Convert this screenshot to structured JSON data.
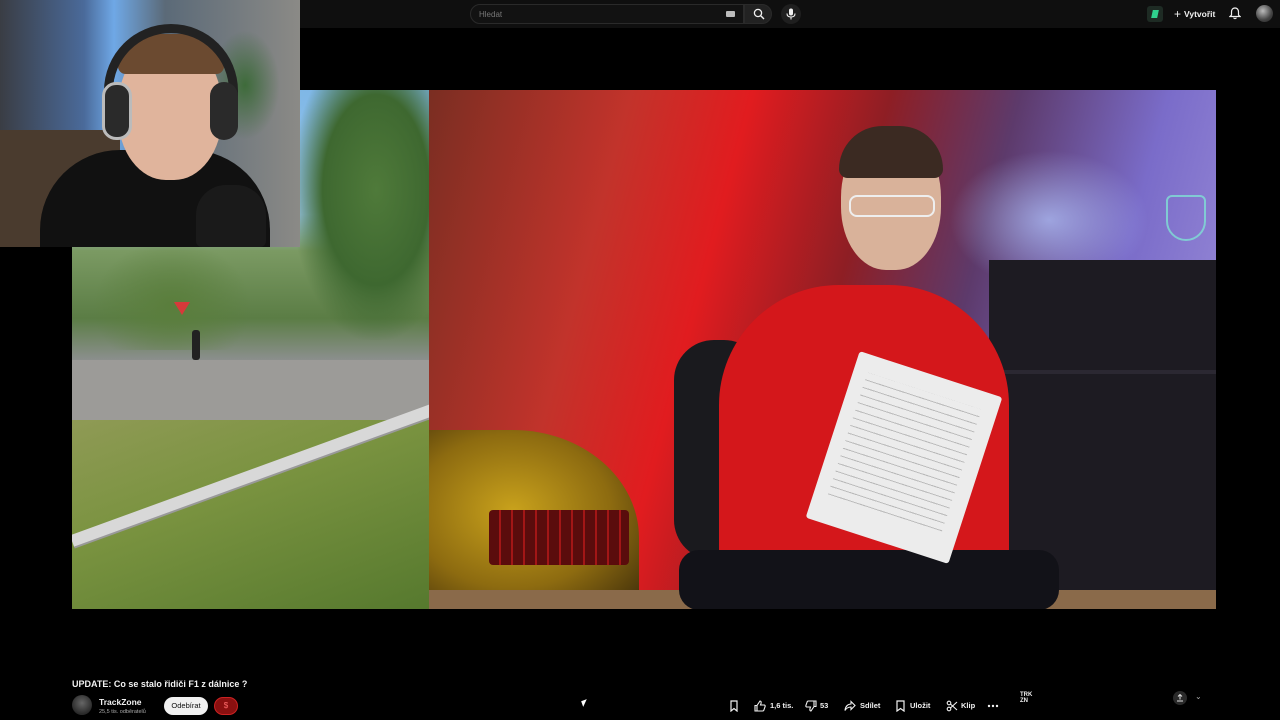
{
  "header": {
    "search_placeholder": "Hledat",
    "create_label": "Vytvořit"
  },
  "video": {
    "title": "UPDATE: Co se stalo řidiči F1 z dálnice ?"
  },
  "channel": {
    "name": "TrackZone",
    "subscribers": "25,5 tis. odběratelů",
    "unsubscribe_label": "Odebírat",
    "join_label": "$"
  },
  "actions": {
    "likes": "1,6 tis.",
    "dislikes": "53",
    "share_label": "Sdílet",
    "save_label": "Uložit",
    "clip_label": "Klip"
  },
  "side_panel": {
    "logo_text": "TRK ZN"
  },
  "colors": {
    "background": "#000000",
    "topbar": "#0f0f0f",
    "accent_red": "#d4171b",
    "extension_green": "#2fd08d"
  }
}
